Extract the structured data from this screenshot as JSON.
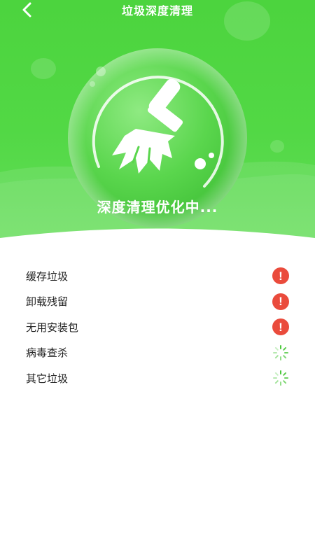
{
  "header": {
    "title": "垃圾深度清理",
    "back_icon": "chevron-left-icon"
  },
  "hero": {
    "status_text": "深度清理优化中...",
    "icon": "broom-icon",
    "colors": {
      "primary_green": "#4cd43e",
      "orb_green": "#55d64a",
      "white": "#ffffff"
    }
  },
  "scan_items": [
    {
      "label": "缓存垃圾",
      "status": "warning",
      "icon": "alert-icon"
    },
    {
      "label": "卸载残留",
      "status": "warning",
      "icon": "alert-icon"
    },
    {
      "label": "无用安装包",
      "status": "warning",
      "icon": "alert-icon"
    },
    {
      "label": "病毒查杀",
      "status": "scanning",
      "icon": "loading-spinner-icon"
    },
    {
      "label": "其它垃圾",
      "status": "scanning",
      "icon": "loading-spinner-icon"
    }
  ],
  "status_colors": {
    "warning": "#ea4b3c",
    "scanning": "#4cc83c"
  }
}
